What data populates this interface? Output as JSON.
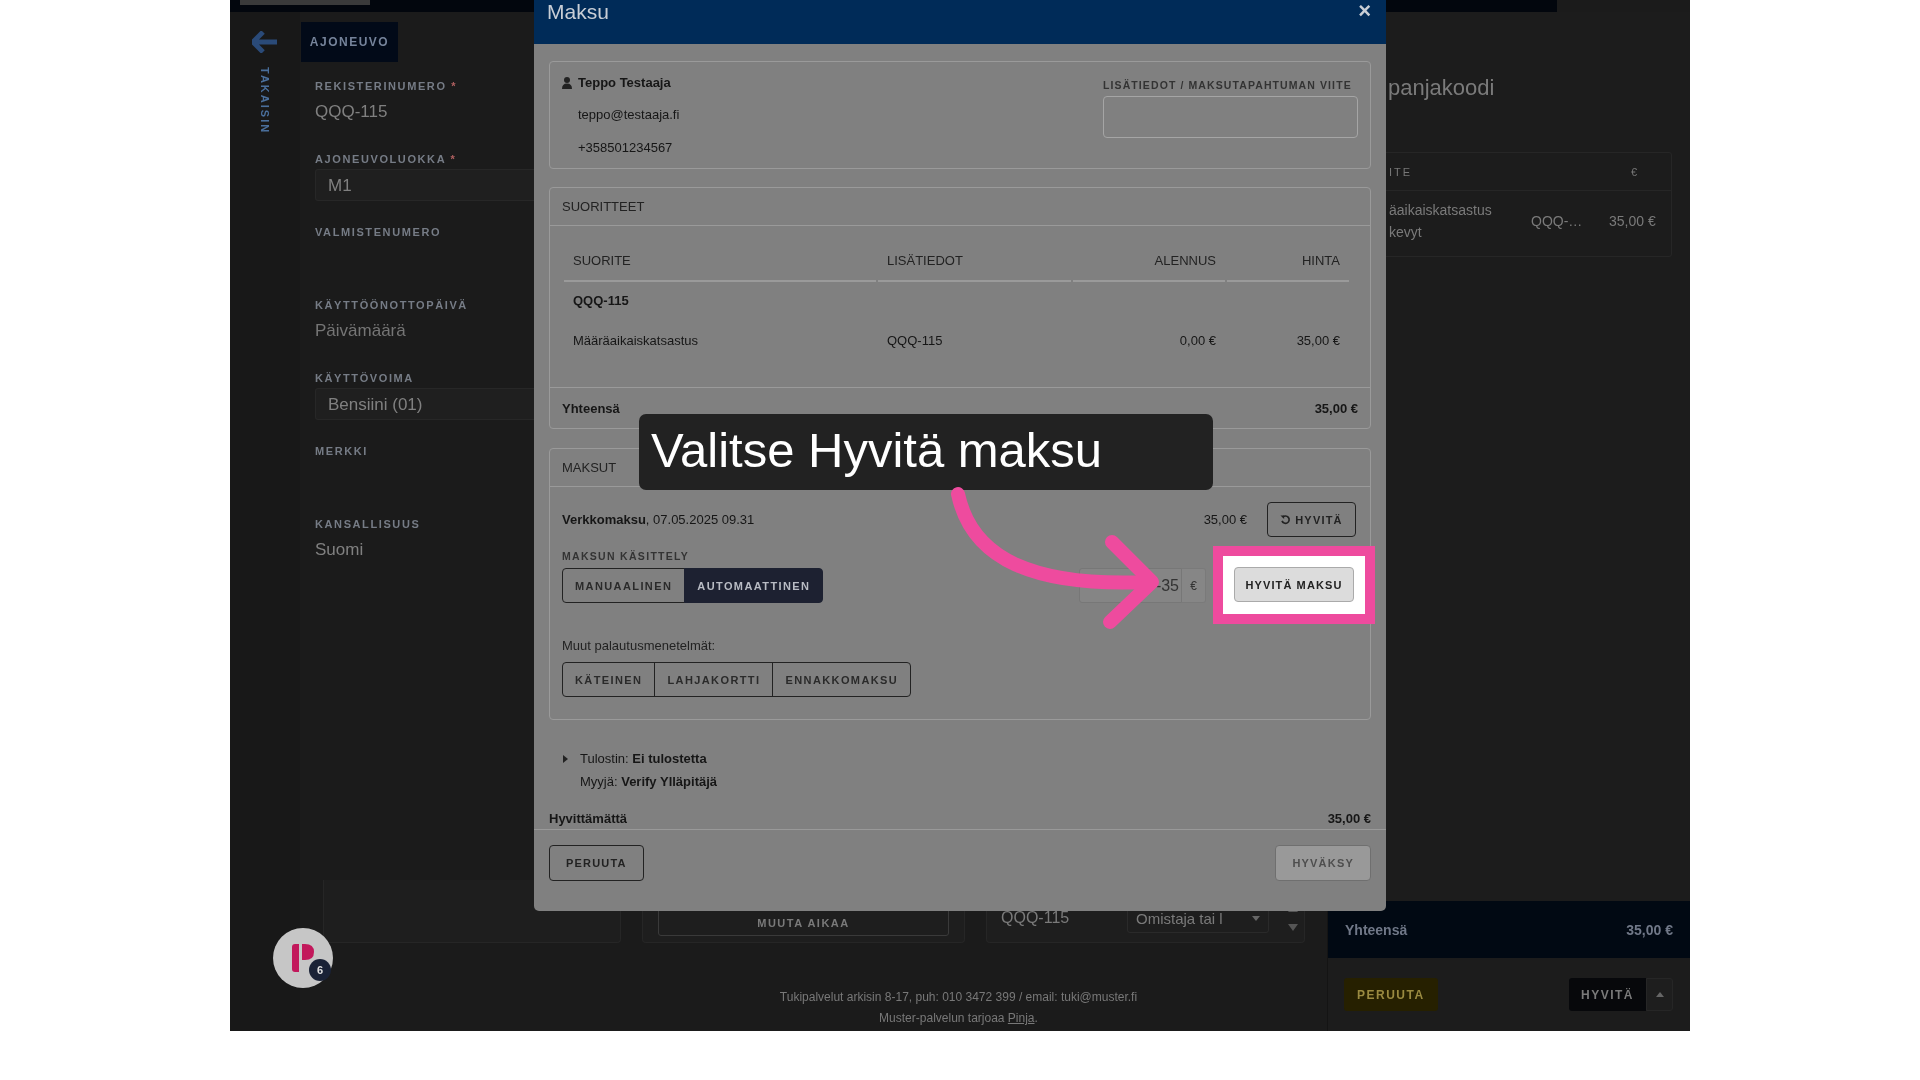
{
  "app": {
    "back_label": "TAKAISIN",
    "tab": "AJONEUVO",
    "fields": [
      {
        "label": "REKISTERINUMERO",
        "required_mark": "*",
        "kind": "text",
        "value": "QQQ-115"
      },
      {
        "label": "AJONEUVOLUOKKA",
        "required_mark": "*",
        "kind": "select",
        "value": "M1"
      },
      {
        "label": "VALMISTENUMERO",
        "kind": "text"
      },
      {
        "label": "KÄYTTÖÖNOTTOPÄIVÄ",
        "kind": "text",
        "placeholder": "Päivämäärä"
      },
      {
        "label": "KÄYTTÖVOIMA",
        "kind": "select",
        "value": "Bensiini (01)"
      },
      {
        "label": "MERKKI",
        "kind": "text"
      },
      {
        "label": "KANSALLISUUS",
        "kind": "text",
        "value": "Suomi"
      }
    ],
    "bottom": {
      "button": "MUUTA AIKAA",
      "plate": "QQQ-115",
      "select": "Omistaja tai l"
    },
    "footer": {
      "support": "Tukipalvelut arkisin 8-17, puh: 010 3472 399 / email: tuki@muster.fi",
      "provider": "Muster-palvelun tarjoaa",
      "provider_link": "Pinja",
      "provider_end": "."
    },
    "right_panel": {
      "heading": "panjakoodi",
      "columns": [
        "ITE",
        "€"
      ],
      "rows": [
        {
          "item_lines": [
            "äaikaiskatsastus",
            "kevyt"
          ],
          "plate": "QQQ-…",
          "price": "35,00 €"
        }
      ],
      "total_label": "Yhteensä",
      "total": "35,00 €",
      "cancel": "PERUUTA",
      "confirm": "HYVITÄ"
    },
    "badge": "6"
  },
  "modal": {
    "title": "Maksu",
    "close": "×",
    "customer": {
      "name": "Teppo Testaaja",
      "email": "teppo@testaaja.fi",
      "phone": "+358501234567"
    },
    "reference": {
      "label": "LISÄTIEDOT / MAKSUTAPAHTUMAN VIITE"
    },
    "services": {
      "title": "SUORITTEET",
      "columns": [
        "SUORITE",
        "LISÄTIEDOT",
        "ALENNUS",
        "HINTA"
      ],
      "groups": [
        {
          "name": "QQQ-115",
          "rows": [
            {
              "cells": [
                "Määräaikaiskatsastus",
                "QQQ-115",
                "0,00 €",
                "35,00 €"
              ]
            }
          ]
        }
      ],
      "total_label": "Yhteensä",
      "total": "35,00 €"
    },
    "payments": {
      "title": "MAKSUT",
      "items": [
        {
          "text": "**Verkkomaksu**, 07.05.2025 09.31",
          "amount": "35,00 €",
          "refund": "HYVITÄ"
        }
      ],
      "handling_label": "MAKSUN KÄSITTELY",
      "handling_options": [
        {
          "label": "MANUAALINEN",
          "selected": false
        },
        {
          "label": "AUTOMAATTINEN",
          "selected": true
        }
      ],
      "refund_amount": "-35",
      "currency": "€",
      "refund_button": "HYVITÄ MAKSU",
      "highlighted": true,
      "other_label": "Muut palautusmenetelmät:",
      "other_methods": [
        "KÄTEINEN",
        "LAHJAKORTTI",
        "ENNAKKOMAKSU"
      ]
    },
    "details": [
      {
        "text": "Tulostin: **Ei tulostetta**",
        "expandable": true
      },
      {
        "text": "Myyjä: **Verify Ylläpitäjä**",
        "expandable": false
      }
    ],
    "unrefunded_label": "Hyvittämättä",
    "unrefunded": "35,00 €",
    "cancel": "PERUUTA",
    "confirm": {
      "label": "HYVÄKSY",
      "disabled": true
    }
  },
  "callout": {
    "text": "Valitse Hyvitä maksu"
  }
}
